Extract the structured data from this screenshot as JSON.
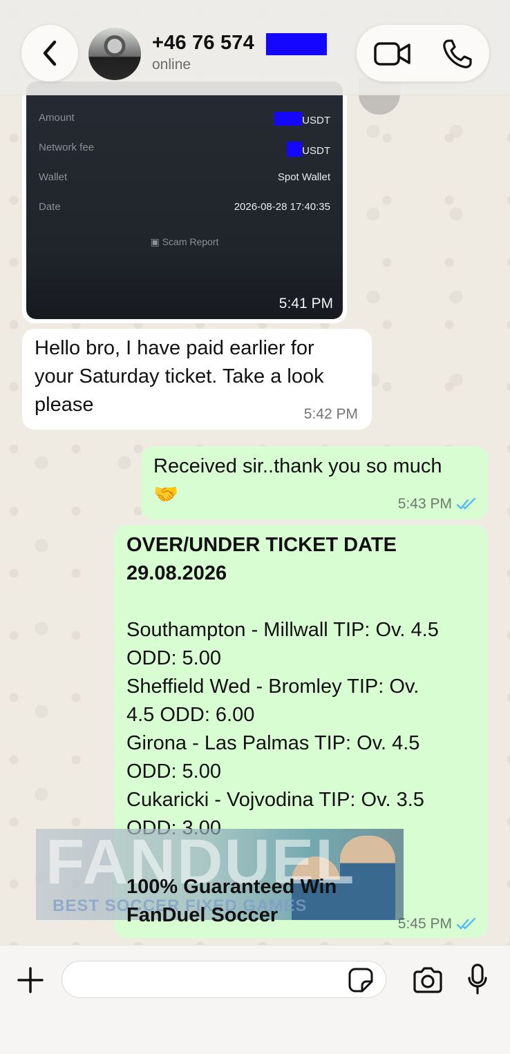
{
  "header": {
    "contact_name": "+46 76 574",
    "status": "online"
  },
  "receipt": {
    "rows": [
      {
        "label": "Amount",
        "value": "USDT"
      },
      {
        "label": "Network fee",
        "value": "USDT"
      },
      {
        "label": "Wallet",
        "value": "Spot Wallet"
      },
      {
        "label": "Date",
        "value": "2026-08-28 17:40:35"
      }
    ],
    "scam_report": "Scam Report",
    "time": "5:41 PM"
  },
  "messages": {
    "m1": {
      "line1": "Hello bro, I have paid earlier for",
      "line2": "your Saturday ticket. Take a look",
      "line3": "please",
      "time": "5:42 PM"
    },
    "m2": {
      "line1": "Received sir..thank you so much",
      "emoji": "🤝",
      "time": "5:43 PM"
    },
    "m3": {
      "title1": "OVER/UNDER TICKET DATE",
      "title2": "29.08.2026",
      "lines": [
        "Southampton - Millwall  TIP: Ov. 4.5",
        "ODD: 5.00",
        "Sheffield Wed - Bromley  TIP: Ov.",
        "4.5 ODD: 6.00",
        "Girona - Las Palmas  TIP: Ov. 4.5",
        "ODD: 5.00",
        "Cukaricki - Vojvodina  TIP: Ov. 3.5",
        "ODD: 3.00"
      ],
      "footer1": "100% Guaranteed Win",
      "footer2": "FanDuel Soccer",
      "time": "5:45 PM"
    }
  },
  "banner": {
    "logo": "FANDUEL",
    "sub": "BEST SOCCER FIXED GAMES"
  },
  "composer": {
    "value": ""
  },
  "colors": {
    "outgoing_bubble": "#d9fdd3",
    "incoming_bubble": "#ffffff",
    "read_ticks": "#53bdeb",
    "redaction": "#1406ff"
  }
}
